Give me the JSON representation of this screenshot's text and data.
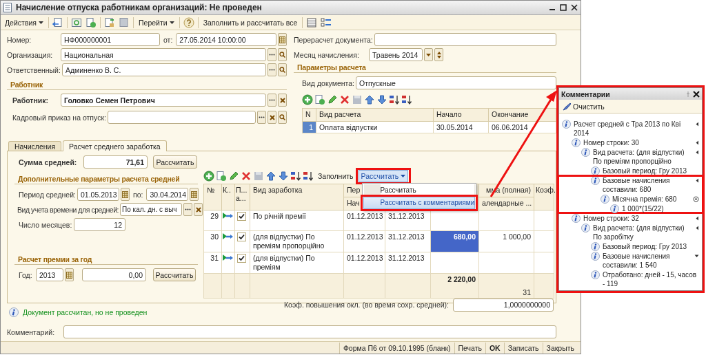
{
  "window": {
    "title": "Начисление отпуска работникам организаций: Не проведен"
  },
  "toolbar": {
    "actions": "Действия",
    "goto": "Перейти",
    "fill_all": "Заполнить и рассчитать все"
  },
  "number": {
    "label": "Номер:",
    "value": "НФ000000001"
  },
  "date": {
    "label": "от:",
    "value": "27.05.2014 10:00:00"
  },
  "organization": {
    "label": "Организация:",
    "value": "Национальная"
  },
  "responsible": {
    "label": "Ответственный:",
    "value": "Админенко В. С."
  },
  "worker_section": {
    "title": "Работник",
    "worker_label": "Работник:",
    "worker": "Головко Семен Петрович",
    "order_label": "Кадровый приказ на отпуск:"
  },
  "recalc_document": {
    "label": "Перерасчет документа:"
  },
  "accrual_month": {
    "label": "Месяц начисления:",
    "value": "Травень 2014"
  },
  "calc_params": {
    "title": "Параметры расчета",
    "doc_type_label": "Вид документа:",
    "doc_type": "Отпускные",
    "columns": [
      "N",
      "Вид расчета",
      "Начало",
      "Окончание"
    ],
    "rows": [
      {
        "n": "1",
        "type": "Оплата відпустки",
        "start": "30.05.2014",
        "end": "06.06.2014"
      }
    ]
  },
  "tabs": [
    {
      "label": "Начисления",
      "selected": false
    },
    {
      "label": "Расчет среднего заработка",
      "selected": true
    }
  ],
  "average_sum": {
    "label": "Сумма средней:",
    "value": "71,61",
    "button": "Рассчитать"
  },
  "extra_params": {
    "title": "Дополнительные параметры расчета средней",
    "period_label": "Период средней:",
    "period_from": "01.05.2013",
    "to_label": "по:",
    "period_to": "30.04.2014",
    "time_label": "Вид учета времени для средней:",
    "time_value": "По кал. дн. с выч",
    "months_label": "Число месяцев:",
    "months": "12"
  },
  "bonus": {
    "title": "Расчет премии за год",
    "year_label": "Год:",
    "year": "2013",
    "amount": "0,00",
    "button": "Рассчитать"
  },
  "earnings": {
    "fill": "Заполнить",
    "calc": "Рассчитать",
    "menu": [
      {
        "label": "Рассчитать",
        "selected": false
      },
      {
        "label": "Рассчитать с комментариями",
        "selected": true
      }
    ],
    "columns": {
      "n": "№",
      "k": "К..",
      "p": "П... а...",
      "kind": "Вид заработка",
      "period_top": "Пер",
      "period_bottom": "Нач",
      "sum_top": "мма (полная)",
      "sum_bottom": "алендарные ...",
      "coef": "Коэф."
    },
    "rows": [
      {
        "n": "29",
        "checked": true,
        "text": "По річній премії",
        "from": "01.12.2013",
        "to": "31.12.2013",
        "selected": false,
        "cut": false
      },
      {
        "n": "30",
        "checked": true,
        "text": "(для відпустки) По преміям пропорційно",
        "from": "01.12.2013",
        "to": "31.12.2013",
        "amount": "680,00",
        "full": "1 000,00",
        "selected": true,
        "cut": false
      },
      {
        "n": "31",
        "checked": true,
        "text": "(для відпустки) По преміям",
        "from": "01.12.2013",
        "to": "31.12.2013",
        "selected": false,
        "cut": true
      }
    ],
    "totals": {
      "amount": "2 220,00",
      "days": "31"
    }
  },
  "coef": {
    "label": "Коэф. повышения окл. (во время сохр. средней):",
    "value": "1,0000000000"
  },
  "message": "Документ рассчитан, но не проведен",
  "comment": {
    "label": "Комментарий:"
  },
  "footer": [
    {
      "label": "Форма П6 от 09.10.1995 (бланк)",
      "default": false
    },
    {
      "label": "Печать",
      "default": false
    },
    {
      "label": "OK",
      "default": true
    },
    {
      "label": "Записать",
      "default": false
    },
    {
      "label": "Закрыть",
      "default": false
    }
  ],
  "comments_panel": {
    "title": "Комментарии",
    "clear": "Очистить",
    "tree": [
      {
        "text": "Расчет средней с Тра 2013 по Кві 2014",
        "kind": "expanded",
        "highlighted": false,
        "children": [
          {
            "text": "Номер строки: 30",
            "kind": "expanded",
            "highlighted": false,
            "children": [
              {
                "text": "Вид расчета: (для відпустки) По преміям пропорційно",
                "kind": "expanded",
                "highlighted": false,
                "children": [
                  {
                    "text": "Базовый период: Гру 2013",
                    "highlighted": false
                  },
                  {
                    "text": "Базовые начисления составили: 680",
                    "kind": "expanded",
                    "highlighted": true,
                    "children": [
                      {
                        "text": "Місячна премія: 680",
                        "kind": "marked",
                        "highlighted": false,
                        "children": [
                          {
                            "text": "1 000*(15/22)",
                            "highlighted": false
                          }
                        ]
                      }
                    ]
                  }
                ]
              }
            ]
          },
          {
            "text": "Номер строки: 32",
            "kind": "expanded",
            "highlighted": false,
            "children": [
              {
                "text": "Вид расчета: (для відпустки) По заробітку",
                "kind": "expanded",
                "highlighted": false,
                "children": [
                  {
                    "text": "Базовый период: Гру 2013",
                    "highlighted": false
                  },
                  {
                    "text": "Базовые начисления составили: 1 540",
                    "kind": "collapsed",
                    "highlighted": false
                  },
                  {
                    "text": "Отработано: дней - 15, часов - 119",
                    "highlighted": false
                  }
                ]
              }
            ]
          }
        ]
      }
    ]
  }
}
